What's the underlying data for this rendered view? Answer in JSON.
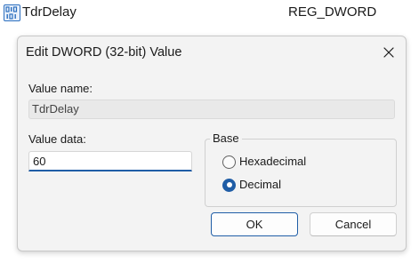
{
  "registry_row": {
    "value_name": "TdrDelay",
    "value_type": "REG_DWORD",
    "icon": "registry-binary-value-icon"
  },
  "dialog": {
    "title": "Edit DWORD (32-bit) Value",
    "close_icon": "close-icon",
    "value_name_label": "Value name:",
    "value_name": "TdrDelay",
    "value_data_label": "Value data:",
    "value_data": "60",
    "base": {
      "legend": "Base",
      "options": [
        {
          "label": "Hexadecimal",
          "selected": false
        },
        {
          "label": "Decimal",
          "selected": true
        }
      ]
    },
    "ok_label": "OK",
    "cancel_label": "Cancel"
  },
  "colors": {
    "accent": "#1f5da6",
    "dialog_background": "#f3f3f3",
    "icon_blue": "#2c6fbf"
  }
}
